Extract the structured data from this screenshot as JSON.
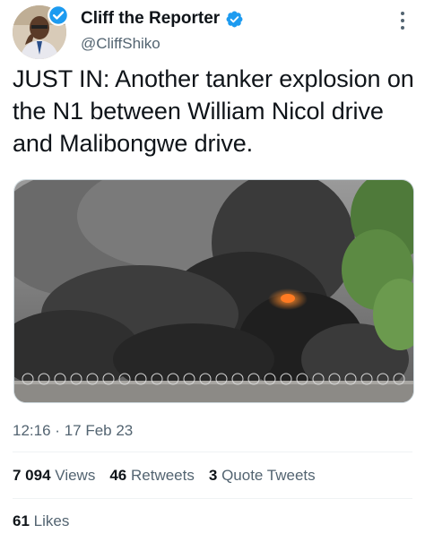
{
  "author": {
    "display_name": "Cliff the Reporter",
    "handle": "@CliffShiko",
    "verified": true,
    "verified_icon": "verified-badge-icon"
  },
  "tweet": {
    "text": "JUST IN: Another tanker explosion on the N1 between William Nicol drive and Malibongwe drive."
  },
  "media": {
    "description_icon": "photo"
  },
  "meta": {
    "time": "12:16",
    "separator": "·",
    "date": "17 Feb 23"
  },
  "stats": {
    "views_count": "7 094",
    "views_label": "Views",
    "retweets_count": "46",
    "retweets_label": "Retweets",
    "quotes_count": "3",
    "quotes_label": "Quote Tweets",
    "likes_count": "61",
    "likes_label": "Likes"
  },
  "colors": {
    "verified_blue": "#1d9bf0",
    "text_primary": "#0f1419",
    "text_secondary": "#536471"
  }
}
